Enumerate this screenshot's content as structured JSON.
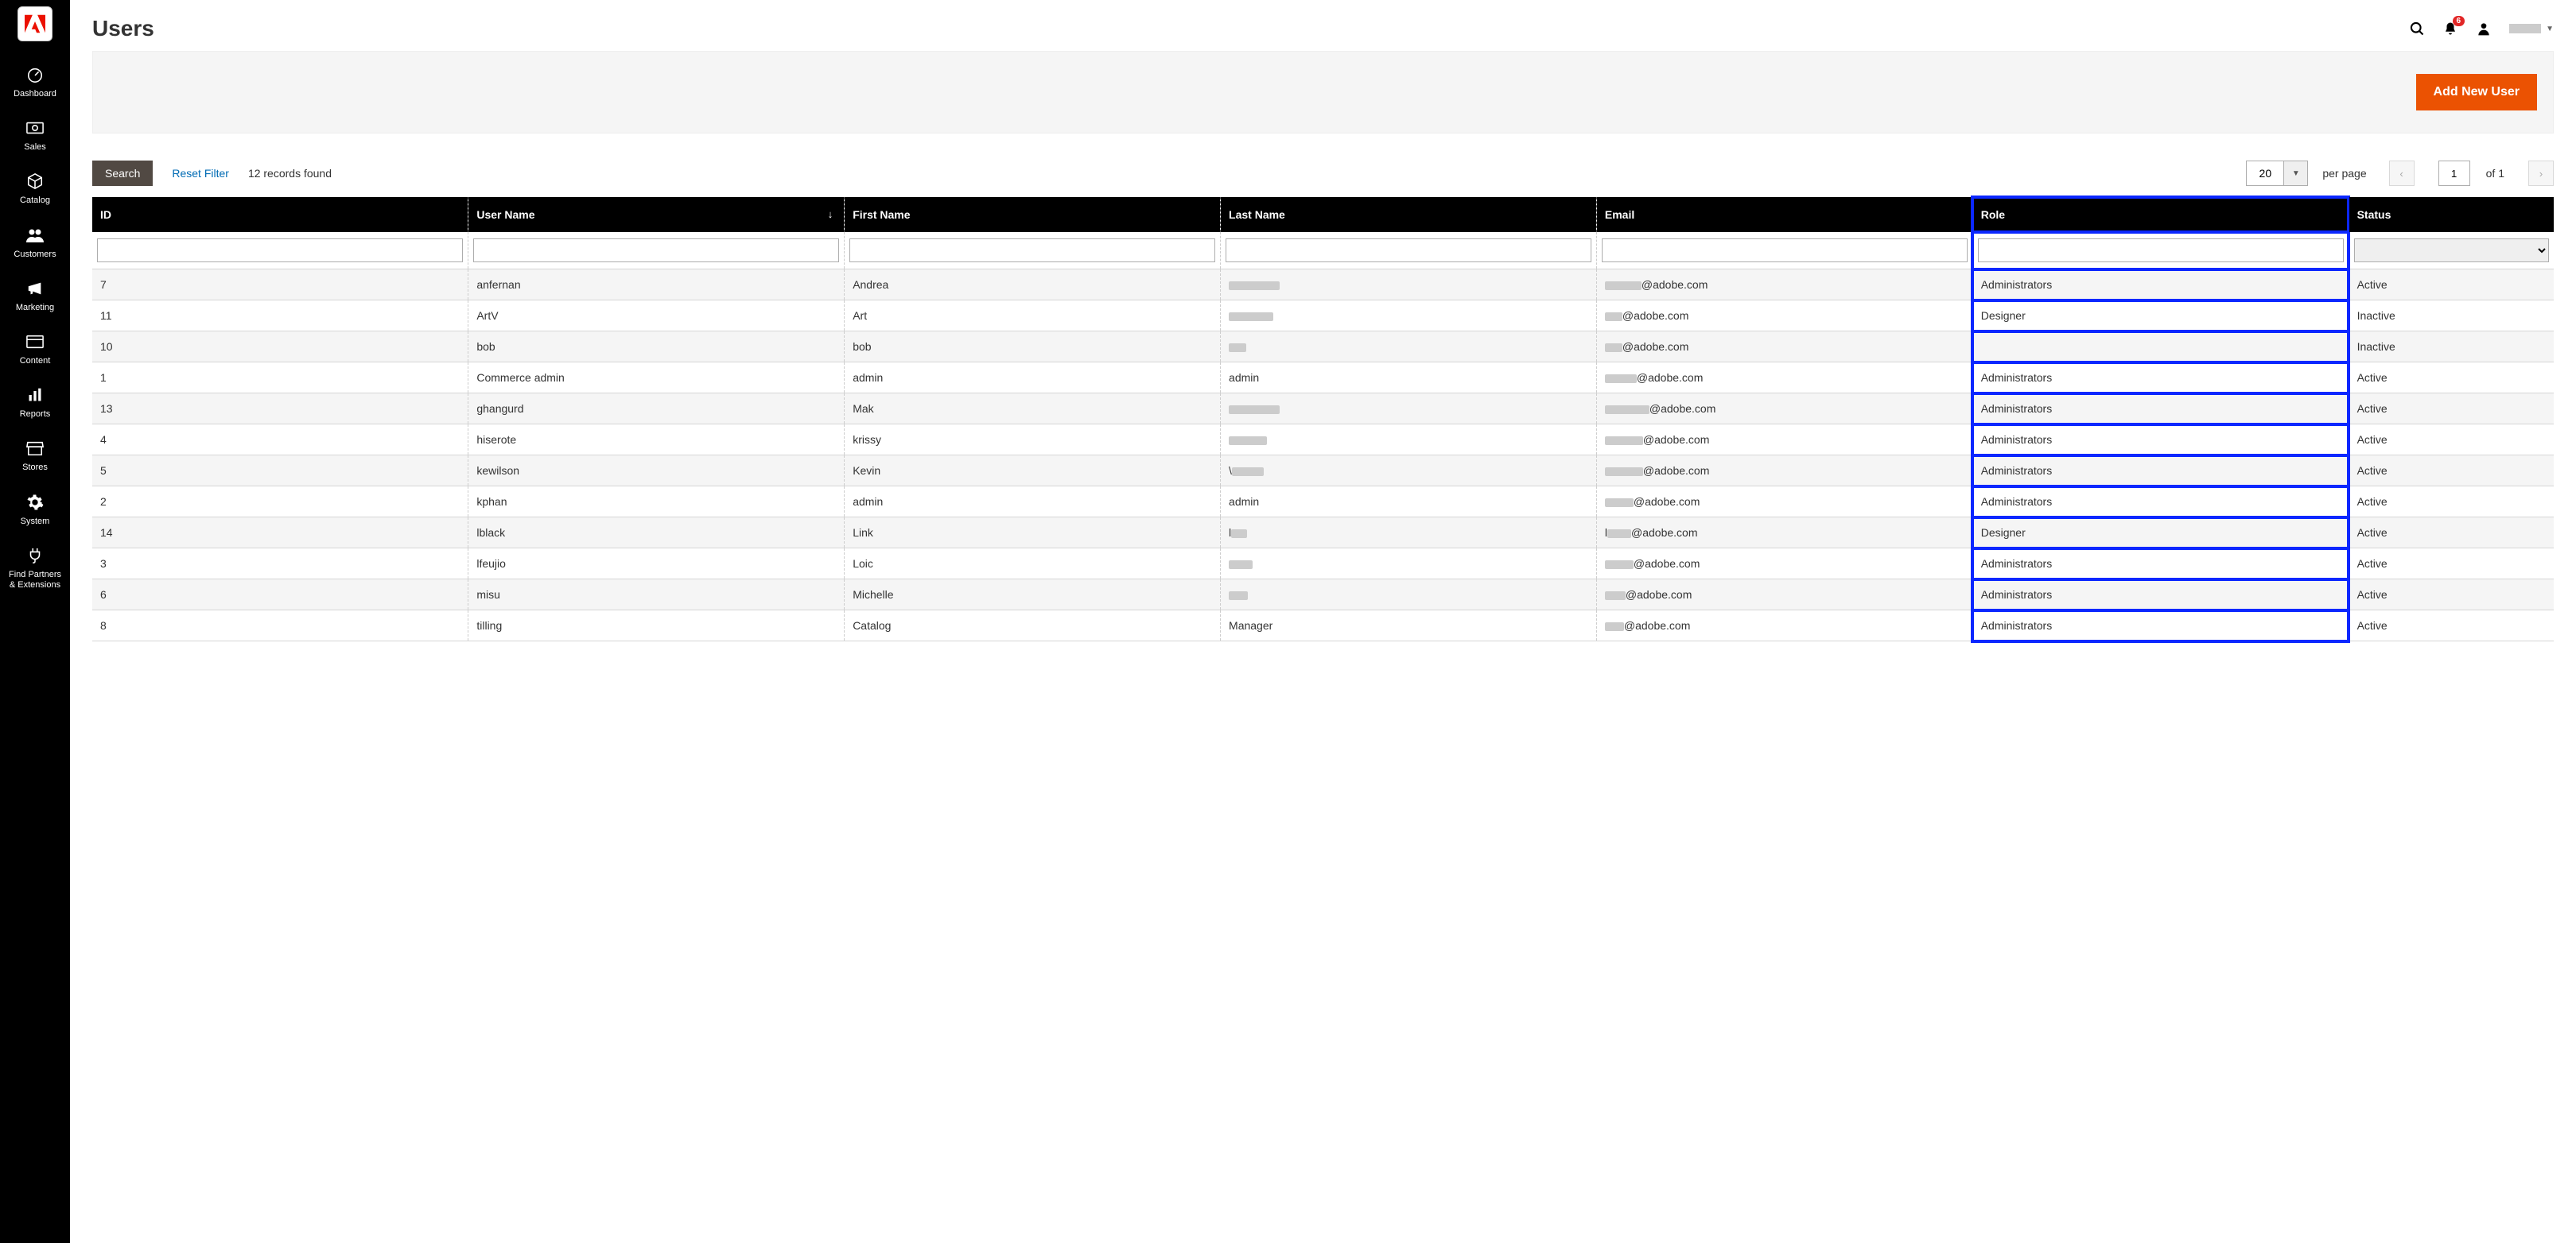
{
  "header": {
    "title": "Users",
    "notifications_count": "6",
    "add_button": "Add New User"
  },
  "sidebar": {
    "items": [
      {
        "label": "Dashboard",
        "icon": "gauge"
      },
      {
        "label": "Sales",
        "icon": "money"
      },
      {
        "label": "Catalog",
        "icon": "cube"
      },
      {
        "label": "Customers",
        "icon": "people"
      },
      {
        "label": "Marketing",
        "icon": "megaphone"
      },
      {
        "label": "Content",
        "icon": "card"
      },
      {
        "label": "Reports",
        "icon": "bars"
      },
      {
        "label": "Stores",
        "icon": "store"
      },
      {
        "label": "System",
        "icon": "gear"
      },
      {
        "label": "Find Partners\n& Extensions",
        "icon": "plug"
      }
    ]
  },
  "controls": {
    "search_label": "Search",
    "reset_label": "Reset Filter",
    "records_found": "12 records found",
    "per_page_value": "20",
    "per_page_label": "per page",
    "page_value": "1",
    "page_total_prefix": "of",
    "page_total": "1"
  },
  "table": {
    "columns": [
      {
        "key": "id",
        "label": "ID"
      },
      {
        "key": "user",
        "label": "User Name",
        "sorted": "desc"
      },
      {
        "key": "first",
        "label": "First Name"
      },
      {
        "key": "last",
        "label": "Last Name"
      },
      {
        "key": "email",
        "label": "Email"
      },
      {
        "key": "role",
        "label": "Role"
      },
      {
        "key": "status",
        "label": "Status"
      }
    ],
    "rows": [
      {
        "id": "7",
        "user": "anfernan",
        "first": "Andrea",
        "last_blur": 64,
        "email_blur": 46,
        "email_suffix": "@adobe.com",
        "role": "Administrators",
        "status": "Active"
      },
      {
        "id": "11",
        "user": "ArtV",
        "first": "Art",
        "last_blur": 56,
        "email_blur": 22,
        "email_suffix": "@adobe.com",
        "role": "Designer",
        "status": "Inactive"
      },
      {
        "id": "10",
        "user": "bob",
        "first": "bob",
        "last_blur": 22,
        "email_blur": 22,
        "email_suffix": "@adobe.com",
        "role": "",
        "status": "Inactive"
      },
      {
        "id": "1",
        "user": "Commerce admin",
        "first": "admin",
        "last": "admin",
        "email_blur": 40,
        "email_suffix": "@adobe.com",
        "role": "Administrators",
        "status": "Active"
      },
      {
        "id": "13",
        "user": "ghangurd",
        "first": "Mak",
        "last_blur": 64,
        "email_blur": 56,
        "email_suffix": "@adobe.com",
        "role": "Administrators",
        "status": "Active"
      },
      {
        "id": "4",
        "user": "hiserote",
        "first": "krissy",
        "last_blur": 48,
        "email_blur": 48,
        "email_suffix": "@adobe.com",
        "role": "Administrators",
        "status": "Active"
      },
      {
        "id": "5",
        "user": "kewilson",
        "first": "Kevin",
        "last_blur": 40,
        "last_prefix": "\\",
        "email_blur": 48,
        "email_suffix": "@adobe.com",
        "role": "Administrators",
        "status": "Active"
      },
      {
        "id": "2",
        "user": "kphan",
        "first": "admin",
        "last": "admin",
        "email_blur": 36,
        "email_suffix": "@adobe.com",
        "role": "Administrators",
        "status": "Active"
      },
      {
        "id": "14",
        "user": "lblack",
        "first": "Link",
        "last_blur": 20,
        "last_prefix": "l",
        "email_blur": 30,
        "email_prefix": "l",
        "email_suffix": "@adobe.com",
        "role": "Designer",
        "status": "Active"
      },
      {
        "id": "3",
        "user": "lfeujio",
        "first": "Loic",
        "last_blur": 30,
        "email_blur": 36,
        "email_suffix": "@adobe.com",
        "role": "Administrators",
        "status": "Active"
      },
      {
        "id": "6",
        "user": "misu",
        "first": "Michelle",
        "last_blur": 24,
        "email_blur": 26,
        "email_suffix": "@adobe.com",
        "role": "Administrators",
        "status": "Active"
      },
      {
        "id": "8",
        "user": "tilling",
        "first": "Catalog",
        "last": "Manager",
        "email_blur": 24,
        "email_suffix": "@adobe.com",
        "role": "Administrators",
        "status": "Active"
      }
    ]
  }
}
